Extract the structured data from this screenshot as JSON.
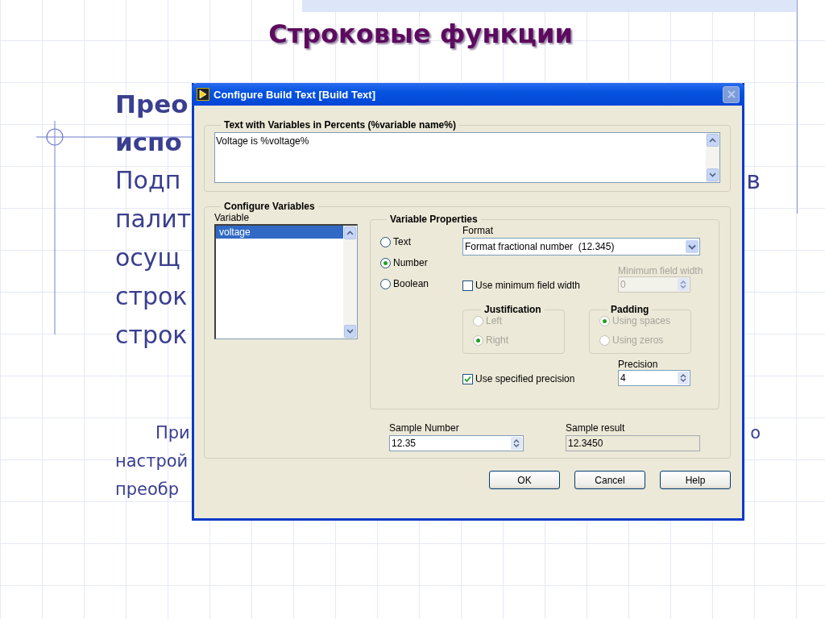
{
  "slide": {
    "title": "Строковые функции",
    "lines": [
      {
        "kind": "heading",
        "left": "Прео"
      },
      {
        "kind": "heading",
        "left": "испо"
      },
      {
        "kind": "body",
        "left": "Подп",
        "right": "в"
      },
      {
        "kind": "body",
        "left": "палит"
      },
      {
        "kind": "body",
        "left": "осущ"
      },
      {
        "kind": "body",
        "left": "строк"
      },
      {
        "kind": "body",
        "left": "строк"
      },
      {
        "kind": "note",
        "left": "При",
        "right": "о"
      },
      {
        "kind": "note",
        "left": "настрой"
      },
      {
        "kind": "note",
        "left": "преобр"
      }
    ]
  },
  "dialog": {
    "title": "Configure Build Text [Build Text]",
    "text_group": {
      "label": "Text with Variables in Percents (%variable name%)",
      "value": "Voltage is %voltage%"
    },
    "configure_group": {
      "label": "Configure Variables",
      "variable_label": "Variable",
      "variables": [
        {
          "name": "voltage",
          "selected": true
        }
      ],
      "properties": {
        "label": "Variable Properties",
        "types": [
          {
            "label": "Text",
            "selected": false
          },
          {
            "label": "Number",
            "selected": true
          },
          {
            "label": "Boolean",
            "selected": false
          }
        ],
        "format": {
          "label": "Format",
          "value": "Format fractional number  (12.345)"
        },
        "use_min_width": {
          "label": "Use minimum field width",
          "checked": false
        },
        "min_width": {
          "label": "Minimum field width",
          "value": "0",
          "disabled": true
        },
        "justification": {
          "label": "Justification",
          "disabled": true,
          "options": [
            {
              "label": "Left",
              "selected": false
            },
            {
              "label": "Right",
              "selected": true
            }
          ]
        },
        "padding": {
          "label": "Padding",
          "disabled": true,
          "options": [
            {
              "label": "Using spaces",
              "selected": true
            },
            {
              "label": "Using zeros",
              "selected": false
            }
          ]
        },
        "use_precision": {
          "label": "Use specified precision",
          "checked": true
        },
        "precision": {
          "label": "Precision",
          "value": "4"
        }
      },
      "sample_number": {
        "label": "Sample Number",
        "value": "12.35"
      },
      "sample_result": {
        "label": "Sample result",
        "value": "12.3450"
      }
    },
    "buttons": [
      "OK",
      "Cancel",
      "Help"
    ]
  }
}
